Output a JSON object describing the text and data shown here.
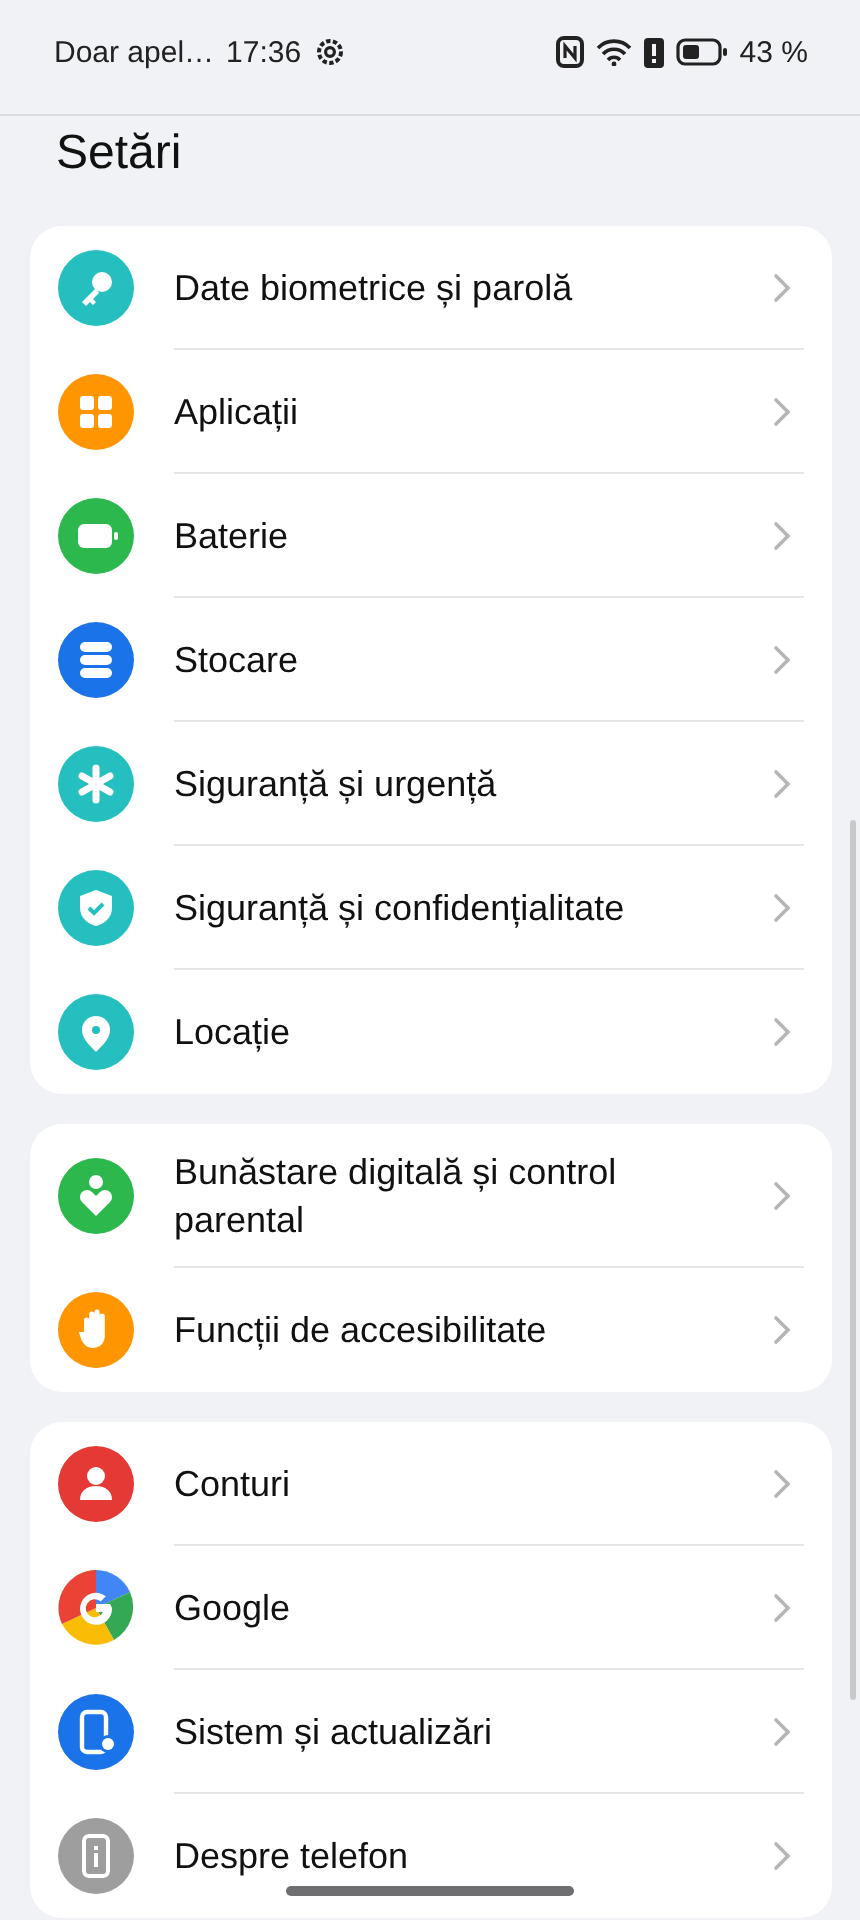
{
  "status_bar": {
    "carrier": "Doar apel…",
    "time": "17:36",
    "battery": "43 %"
  },
  "title": "Setări",
  "sections": [
    {
      "items": [
        {
          "label": "Date biometrice și parolă",
          "color": "#26bfbf"
        },
        {
          "label": "Aplicații",
          "color": "#ff9500"
        },
        {
          "label": "Baterie",
          "color": "#2db84d"
        },
        {
          "label": "Stocare",
          "color": "#1a73e8"
        },
        {
          "label": "Siguranță și urgență",
          "color": "#26bfbf"
        },
        {
          "label": "Siguranță și confidențialitate",
          "color": "#26bfbf"
        },
        {
          "label": "Locație",
          "color": "#26bfbf"
        }
      ]
    },
    {
      "items": [
        {
          "label": "Bunăstare digitală și control parental",
          "color": "#2db84d"
        },
        {
          "label": "Funcții de accesibilitate",
          "color": "#ff9500"
        }
      ]
    },
    {
      "items": [
        {
          "label": "Conturi",
          "color": "#e53935"
        },
        {
          "label": "Google"
        },
        {
          "label": "Sistem și actualizări",
          "color": "#1a73e8"
        },
        {
          "label": "Despre telefon",
          "color": "#9e9e9e"
        }
      ]
    }
  ]
}
